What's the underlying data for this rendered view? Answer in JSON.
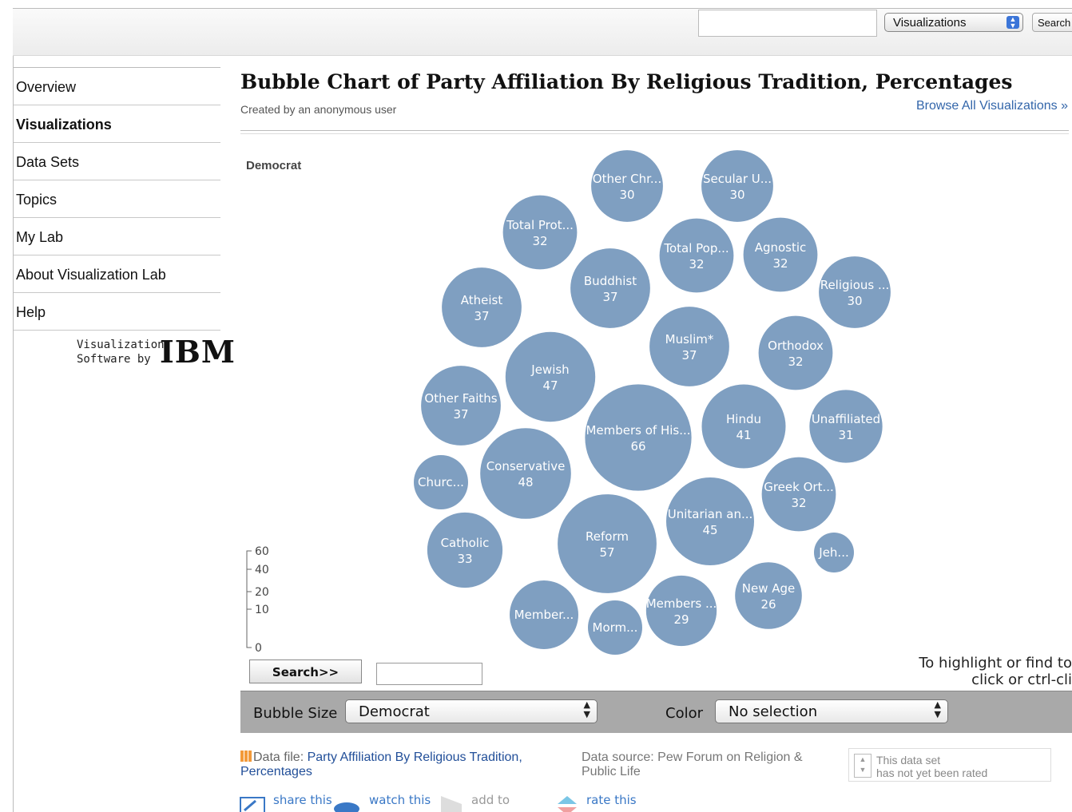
{
  "topbar": {
    "search_value": "",
    "scope_select": "Visualizations",
    "search_button": "Search"
  },
  "nav": {
    "items": [
      {
        "label": "Overview"
      },
      {
        "label": "Visualizations",
        "active": true
      },
      {
        "label": "Data Sets"
      },
      {
        "label": "Topics"
      },
      {
        "label": "My Lab"
      },
      {
        "label": "About Visualization Lab"
      },
      {
        "label": "Help"
      }
    ],
    "sponsor_line1": "Visualization",
    "sponsor_line2": "Software by",
    "sponsor_logo": "IBM"
  },
  "page": {
    "title": "Bubble Chart of Party Affiliation By Religious Tradition, Percentages",
    "byline": "Created by an anonymous user",
    "browse_link": "Browse All Visualizations »"
  },
  "chart_data": {
    "type": "bubble",
    "title": "Democrat",
    "color": "#7f9fc1",
    "size_legend_ticks": [
      60,
      40,
      20,
      10,
      0
    ],
    "bubbles": [
      {
        "label": "Other Chr...",
        "value": 30
      },
      {
        "label": "Secular U...",
        "value": 30
      },
      {
        "label": "Total Prot...",
        "value": 32
      },
      {
        "label": "Total Pop...",
        "value": 32
      },
      {
        "label": "Agnostic",
        "value": 32
      },
      {
        "label": "Buddhist",
        "value": 37
      },
      {
        "label": "Religious ...",
        "value": 30
      },
      {
        "label": "Atheist",
        "value": 37
      },
      {
        "label": "Muslim*",
        "value": 37
      },
      {
        "label": "Orthodox",
        "value": 32
      },
      {
        "label": "Jewish",
        "value": 47
      },
      {
        "label": "Other Faiths",
        "value": 37
      },
      {
        "label": "Members of His...",
        "value": 66
      },
      {
        "label": "Hindu",
        "value": 41
      },
      {
        "label": "Unaffiliated",
        "value": 31
      },
      {
        "label": "Churc...",
        "value": null
      },
      {
        "label": "Conservative",
        "value": 48
      },
      {
        "label": "Greek Ort...",
        "value": 32
      },
      {
        "label": "Unitarian an...",
        "value": 45
      },
      {
        "label": "Catholic",
        "value": 33
      },
      {
        "label": "Reform",
        "value": 57
      },
      {
        "label": "Jeh...",
        "value": null
      },
      {
        "label": "New Age",
        "value": 26
      },
      {
        "label": "Member...",
        "value": null
      },
      {
        "label": "Members ...",
        "value": 29
      },
      {
        "label": "Morm...",
        "value": null
      }
    ]
  },
  "chart_controls": {
    "search_button": "Search>>",
    "search_value": "",
    "hint_line1": "To highlight or find to",
    "hint_line2": "click or ctrl-cli",
    "bubble_size_label": "Bubble Size",
    "bubble_size_value": "Democrat",
    "color_label": "Color",
    "color_value": "No selection"
  },
  "footer": {
    "data_file_label": "Data file:",
    "data_file_link": "Party Affiliation By Religious Tradition, Percentages",
    "data_source": "Data source: Pew Forum on Religion & Public Life",
    "rating_text_1": "This data set",
    "rating_text_2": "has not yet been rated",
    "actions": [
      "share this",
      "watch this",
      "add to",
      "rate this"
    ]
  }
}
